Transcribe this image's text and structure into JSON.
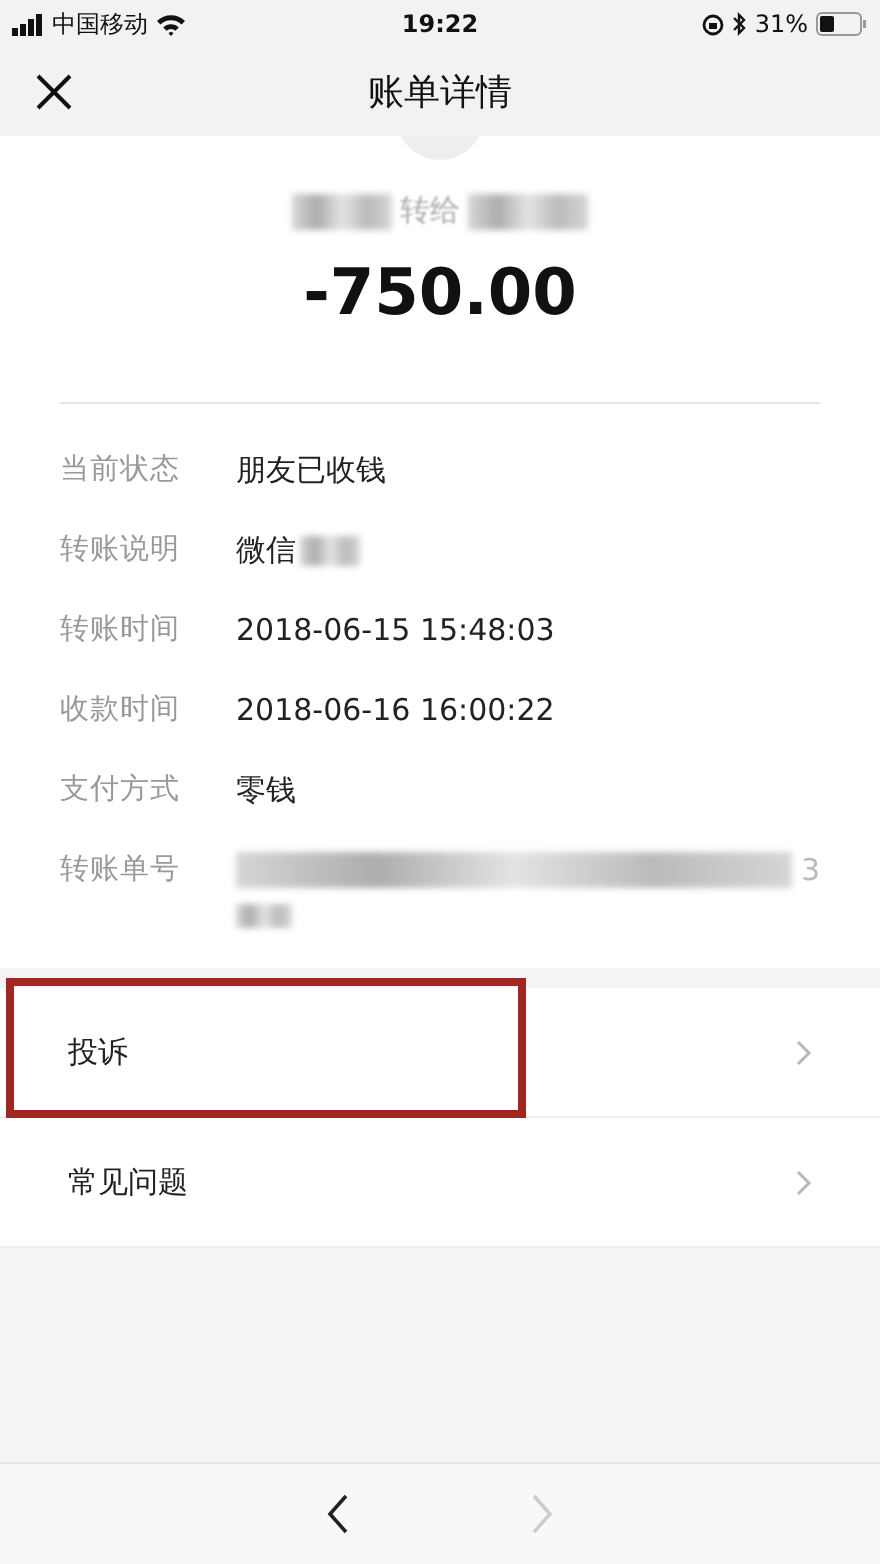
{
  "status_bar": {
    "carrier": "中国移动",
    "time": "19:22",
    "battery": "31%"
  },
  "nav": {
    "title": "账单详情"
  },
  "transfer": {
    "counterpart": "转给",
    "amount": "-750.00"
  },
  "details": [
    {
      "label": "当前状态",
      "value": "朋友已收钱",
      "redacted": false
    },
    {
      "label": "转账说明",
      "value": "微信",
      "redacted": true
    },
    {
      "label": "转账时间",
      "value": "2018-06-15 15:48:03",
      "redacted": false
    },
    {
      "label": "收款时间",
      "value": "2018-06-16 16:00:22",
      "redacted": false
    },
    {
      "label": "支付方式",
      "value": "零钱",
      "redacted": false
    },
    {
      "label": "转账单号",
      "value": "3",
      "redacted": true
    }
  ],
  "menu": [
    {
      "label": "投诉",
      "highlighted": true
    },
    {
      "label": "常见问题",
      "highlighted": false
    }
  ]
}
